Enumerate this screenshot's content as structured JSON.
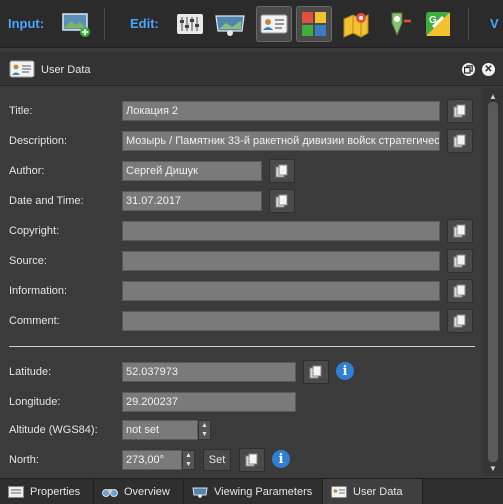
{
  "toolbar": {
    "input_label": "Input:",
    "edit_label": "Edit:",
    "view_label": "V",
    "buttons": [
      {
        "icon": "image-add-icon"
      },
      {
        "icon": "sliders-icon"
      },
      {
        "icon": "image-view-icon"
      },
      {
        "icon": "user-data-icon",
        "active": true
      },
      {
        "icon": "puzzle-icon",
        "active": true
      },
      {
        "icon": "map-pin-icon"
      },
      {
        "icon": "geotag-remove-icon"
      },
      {
        "icon": "google-maps-icon"
      }
    ]
  },
  "panel": {
    "title": "User Data",
    "icon": "id-card-icon"
  },
  "fields": {
    "title": {
      "label": "Title:",
      "value": "Локация 2"
    },
    "description": {
      "label": "Description:",
      "value": "Мозырь / Памятник 33-й ракетной дивизии войск стратегичес"
    },
    "author": {
      "label": "Author:",
      "value": "Сергей Дишук"
    },
    "datetime": {
      "label": "Date and Time:",
      "value": "31.07.2017"
    },
    "copyright": {
      "label": "Copyright:",
      "value": ""
    },
    "source": {
      "label": "Source:",
      "value": ""
    },
    "information": {
      "label": "Information:",
      "value": ""
    },
    "comment": {
      "label": "Comment:",
      "value": ""
    },
    "latitude": {
      "label": "Latitude:",
      "value": "52.037973"
    },
    "longitude": {
      "label": "Longitude:",
      "value": "29.200237"
    },
    "altitude": {
      "label": "Altitude (WGS84):",
      "value": "not set"
    },
    "north": {
      "label": "North:",
      "value": "273,00°",
      "set_label": "Set"
    }
  },
  "tabs": [
    {
      "label": "Properties",
      "icon": "properties-icon",
      "active": false
    },
    {
      "label": "Overview",
      "icon": "binoculars-icon",
      "active": false
    },
    {
      "label": "Viewing Parameters",
      "icon": "viewing-params-icon",
      "active": false
    },
    {
      "label": "User Data",
      "icon": "id-card-icon",
      "active": true
    }
  ],
  "colors": {
    "accent": "#4aa3ff",
    "info": "#2f7fd6",
    "field_bg": "#7a7a7a",
    "panel_bg": "#3b3b3b"
  }
}
